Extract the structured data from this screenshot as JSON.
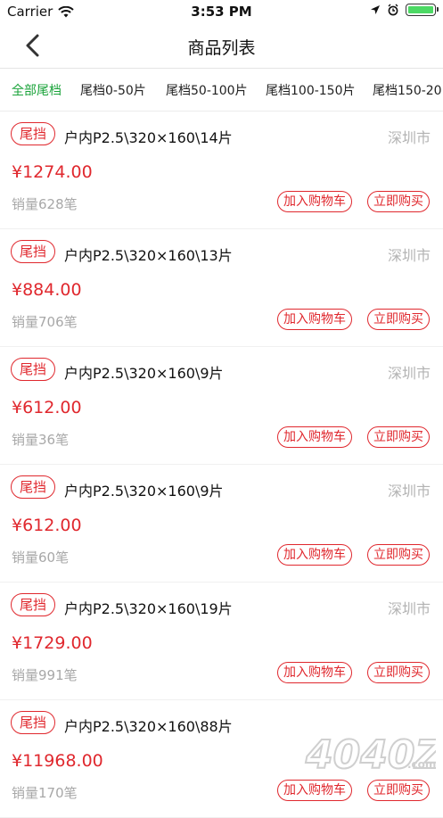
{
  "status": {
    "carrier": "Carrier",
    "time": "3:53 PM"
  },
  "nav": {
    "title": "商品列表"
  },
  "filters": [
    "全部尾档",
    "尾档0-50片",
    "尾档50-100片",
    "尾档100-150片",
    "尾档150-20"
  ],
  "products": [
    {
      "tag": "尾挡",
      "title": "户内P2.5\\320×160\\14片",
      "city": "深圳市",
      "price": "¥1274.00",
      "sales": "销量628笔",
      "cart": "加入购物车",
      "buy": "立即购买"
    },
    {
      "tag": "尾挡",
      "title": "户内P2.5\\320×160\\13片",
      "city": "深圳市",
      "price": "¥884.00",
      "sales": "销量706笔",
      "cart": "加入购物车",
      "buy": "立即购买"
    },
    {
      "tag": "尾挡",
      "title": "户内P2.5\\320×160\\9片",
      "city": "深圳市",
      "price": "¥612.00",
      "sales": "销量36笔",
      "cart": "加入购物车",
      "buy": "立即购买"
    },
    {
      "tag": "尾挡",
      "title": "户内P2.5\\320×160\\9片",
      "city": "深圳市",
      "price": "¥612.00",
      "sales": "销量60笔",
      "cart": "加入购物车",
      "buy": "立即购买"
    },
    {
      "tag": "尾挡",
      "title": "户内P2.5\\320×160\\19片",
      "city": "深圳市",
      "price": "¥1729.00",
      "sales": "销量991笔",
      "cart": "加入购物车",
      "buy": "立即购买"
    },
    {
      "tag": "尾挡",
      "title": "户内P2.5\\320×160\\88片",
      "city": "",
      "price": "¥11968.00",
      "sales": "销量170笔",
      "cart": "加入购物车",
      "buy": "立即购买"
    }
  ],
  "watermark": {
    "text": "4040Z",
    "suffix": ".com"
  },
  "colors": {
    "accent": "#e0282e",
    "active_filter": "#1aa33a",
    "muted": "#a8a8a8",
    "battery": "#4cd964"
  },
  "icons": [
    "wifi-icon",
    "location-icon",
    "alarm-icon",
    "battery-icon",
    "back-chevron-icon"
  ]
}
